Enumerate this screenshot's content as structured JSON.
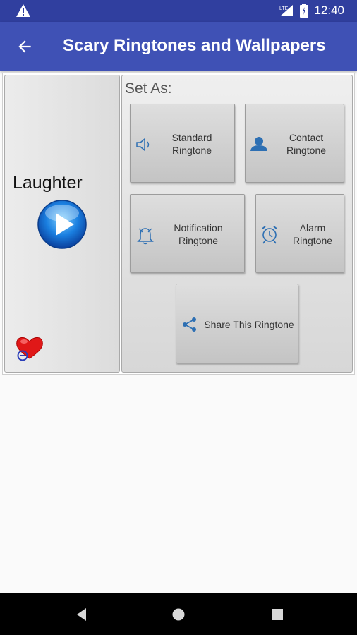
{
  "status_bar": {
    "time": "12:40",
    "network": "LTE",
    "icons": [
      "warning-icon",
      "signal-icon",
      "battery-icon"
    ]
  },
  "app_bar": {
    "title": "Scary Ringtones and Wallpapers",
    "back_icon": "arrow-left-icon"
  },
  "ringtone": {
    "name": "Laughter",
    "play_icon": "play-icon",
    "favorite_icon": "heart-icon"
  },
  "set_as": {
    "label": "Set As:",
    "buttons": {
      "standard": {
        "line1": "Standard",
        "line2": "Ringtone",
        "icon": "speaker-icon"
      },
      "contact": {
        "line1": "Contact",
        "line2": "Ringtone",
        "icon": "contact-icon"
      },
      "notification": {
        "line1": "Notification",
        "line2": "Ringtone",
        "icon": "notification-icon"
      },
      "alarm": {
        "line1": "Alarm",
        "line2": "Ringtone",
        "icon": "alarm-clock-icon"
      },
      "share": {
        "label": "Share This Ringtone",
        "icon": "share-icon"
      }
    }
  },
  "nav_bar": {
    "icons": [
      "back-triangle-icon",
      "home-circle-icon",
      "recents-square-icon"
    ]
  },
  "colors": {
    "status_bar": "#303f9f",
    "app_bar": "#3f51b5",
    "background": "#fafafa",
    "icon_blue": "#2d6fb3"
  }
}
